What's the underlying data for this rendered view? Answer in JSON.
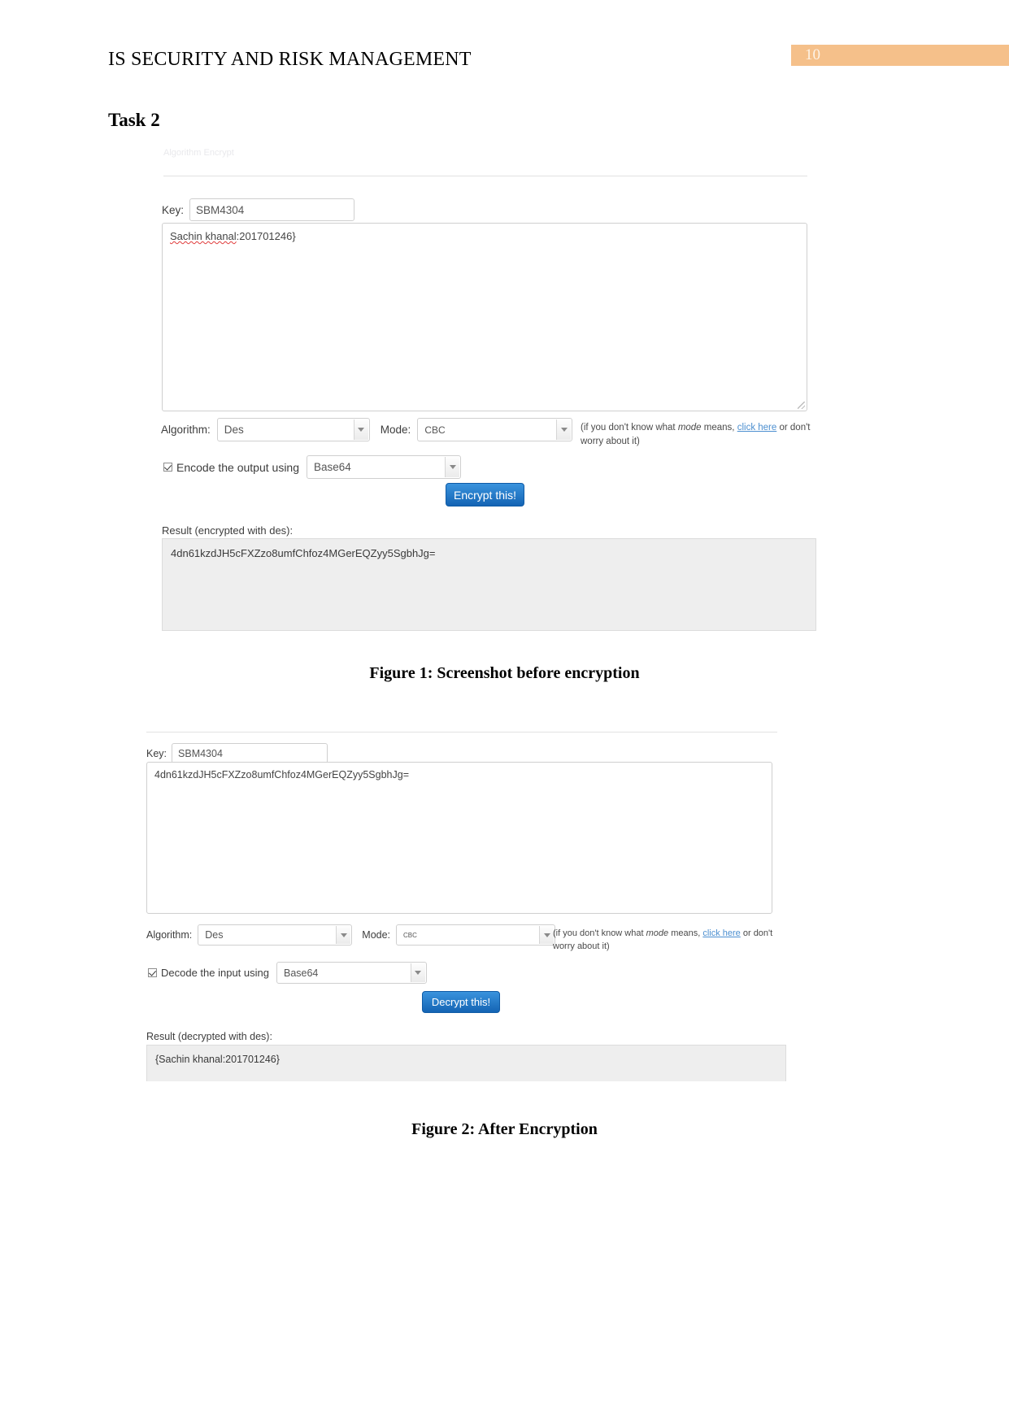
{
  "document": {
    "header_title": "IS SECURITY AND RISK MANAGEMENT",
    "page_number": "10",
    "section_title": "Task 2",
    "figure1_caption": "Figure 1: Screenshot before encryption",
    "figure2_caption": "Figure 2: After Encryption",
    "accent_color": "#f5c08a"
  },
  "figure1": {
    "faint_top_text": "Algorithm  Encrypt",
    "key_label": "Key:",
    "key_value": "SBM4304",
    "input_text": "{Sachin khanal:201701246}",
    "input_spellcheck_part": "Sachin khanal",
    "input_rest": ":201701246}",
    "algorithm_label": "Algorithm:",
    "algorithm_value": "Des",
    "mode_label": "Mode:",
    "mode_value": "CBC",
    "hint_prefix": "(if you don't know what ",
    "hint_em": "mode",
    "hint_mid": " means, ",
    "hint_link": "click here",
    "hint_suffix": " or don't worry about it)",
    "encode_label": "Encode the output using",
    "encoding_value": "Base64",
    "submit_label": "Encrypt this!",
    "result_label": "Result (encrypted with des):",
    "result_value": "4dn61kzdJH5cFXZzo8umfChfoz4MGerEQZyy5SgbhJg="
  },
  "figure2": {
    "key_label": "Key:",
    "key_value": "SBM4304",
    "input_text": "4dn61kzdJH5cFXZzo8umfChfoz4MGerEQZyy5SgbhJg=",
    "algorithm_label": "Algorithm:",
    "algorithm_value": "Des",
    "mode_label": "Mode:",
    "mode_value": "cbc",
    "hint_prefix": "(if you don't know what ",
    "hint_em": "mode",
    "hint_mid": " means, ",
    "hint_link": "click here",
    "hint_suffix": " or don't worry about it)",
    "decode_label": "Decode the input using",
    "encoding_value": "Base64",
    "submit_label": "Decrypt this!",
    "result_label": "Result (decrypted with des):",
    "result_value": "{Sachin khanal:201701246}"
  }
}
